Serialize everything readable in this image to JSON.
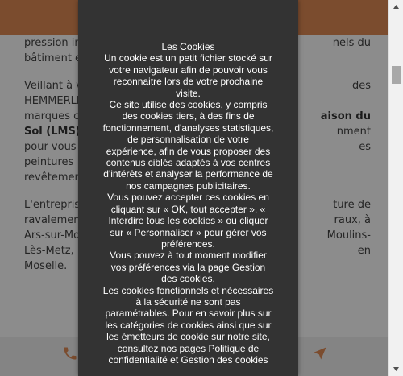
{
  "page": {
    "paragraphs": [
      {
        "lines": [
          {
            "left": "pression immobilie",
            "right": "nels du"
          },
          {
            "left": "bâtiment e",
            "right": ""
          }
        ]
      },
      {
        "lines": [
          {
            "left": "Veillant à v",
            "right": "des"
          },
          {
            "left": "HEMMERLE",
            "right": ""
          },
          {
            "left": "marques c",
            "right": "aison du",
            "right_bold": true
          },
          {
            "left": "Sol (LMS)",
            "left_bold": true,
            "right": "nment"
          },
          {
            "left": "pour vous",
            "right": "es"
          },
          {
            "left": "peintures",
            "right": ""
          },
          {
            "left": "revêtemen",
            "right": ""
          }
        ]
      },
      {
        "lines": [
          {
            "left": "L'entrepris",
            "right": "ture de"
          },
          {
            "left": "ravalemen",
            "right": "raux, à"
          },
          {
            "left": "Ars-sur-Mo",
            "right": "Moulins-"
          },
          {
            "left": "Lès-Metz,",
            "right": "en"
          },
          {
            "left": "Moselle.",
            "right": ""
          }
        ]
      }
    ],
    "bottom_icons": [
      "phone-icon",
      "navigation-arrow-icon"
    ],
    "accent_color": "#e08a54"
  },
  "cookie_banner": {
    "lines": [
      "Les Cookies",
      "Un cookie est un petit fichier stocké sur",
      "votre navigateur afin de pouvoir vous",
      "reconnaitre lors de votre prochaine",
      "visite.",
      "Ce site utilise des cookies, y compris",
      "des cookies tiers, à des fins de",
      "fonctionnement, d'analyses statistiques,",
      "de personnalisation de votre",
      "expérience, afin de vous proposer des",
      "contenus ciblés adaptés à vos centres",
      "d'intérêts et analyser la performance de",
      "nos campagnes publicitaires.",
      "Vous pouvez accepter ces cookies en",
      "cliquant sur « OK, tout accepter », «",
      "Interdire tous les cookies  » ou cliquer",
      "sur « Personnaliser » pour gérer vos",
      "préférences.",
      "Vous pouvez à tout moment modifier",
      "vos préférences via la page Gestion",
      "des cookies.",
      "Les cookies fonctionnels et nécessaires",
      "à la sécurité ne sont pas",
      "paramétrables. Pour en savoir plus sur",
      "les catégories de cookies ainsi que sur",
      "les émetteurs de cookie sur notre site,",
      "consultez nos pages Politique de",
      "confidentialité et Gestion des cookies"
    ],
    "background": "#333333",
    "text_color": "#ffffff"
  }
}
